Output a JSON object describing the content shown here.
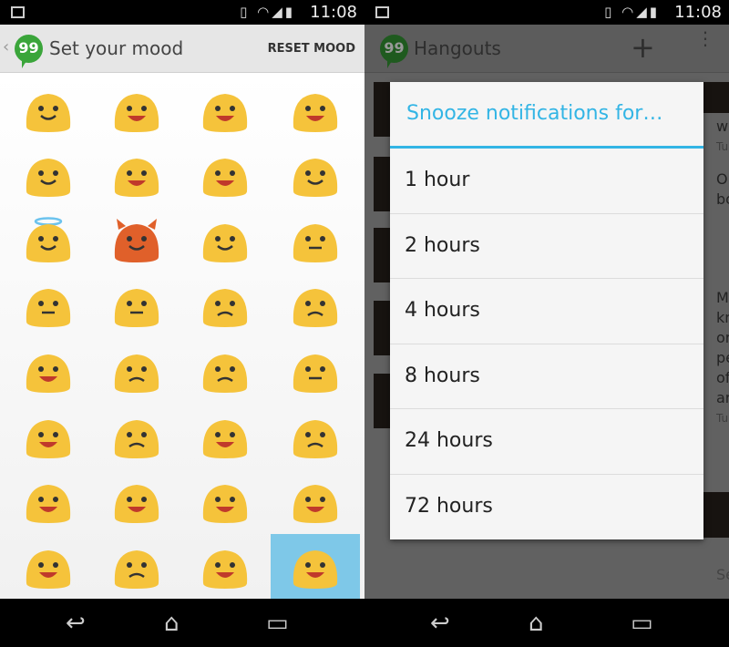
{
  "status": {
    "time": "11:08"
  },
  "left": {
    "title": "Set your mood",
    "reset_label": "RESET MOOD",
    "moods": [
      "smiling-blush",
      "grin",
      "grin-closed-eyes",
      "laugh-tears",
      "smile",
      "laugh-blush",
      "laugh-sweat",
      "wink-tongue",
      "halo",
      "devil",
      "wink",
      "zipper-mouth",
      "neutral",
      "expressionless",
      "confused",
      "angry",
      "grimace",
      "pout",
      "sad-tear",
      "sleepy",
      "surprised",
      "persevere",
      "crying-steam",
      "disappointed",
      "anguished",
      "worried-sweat",
      "fearful-scream",
      "sobbing",
      "crying",
      "frowning",
      "hands-on-cheeks",
      "astonished"
    ],
    "selected_index": 31,
    "selected_color": "#7ec8e8",
    "emoji_color": "#f5c33b",
    "devil_color": "#e0602a"
  },
  "right": {
    "title": "Hangouts",
    "dialog": {
      "title": "Snooze notifications for…",
      "options": [
        "1 hour",
        "2 hours",
        "4 hours",
        "8 hours",
        "24 hours",
        "72 hours"
      ]
    },
    "peek": [
      "w",
      "Tu",
      "Or",
      "bo",
      "M",
      "kn",
      "or",
      "pe",
      "of",
      "ar",
      "Tu",
      "Se"
    ],
    "accent": "#33b5e5"
  }
}
